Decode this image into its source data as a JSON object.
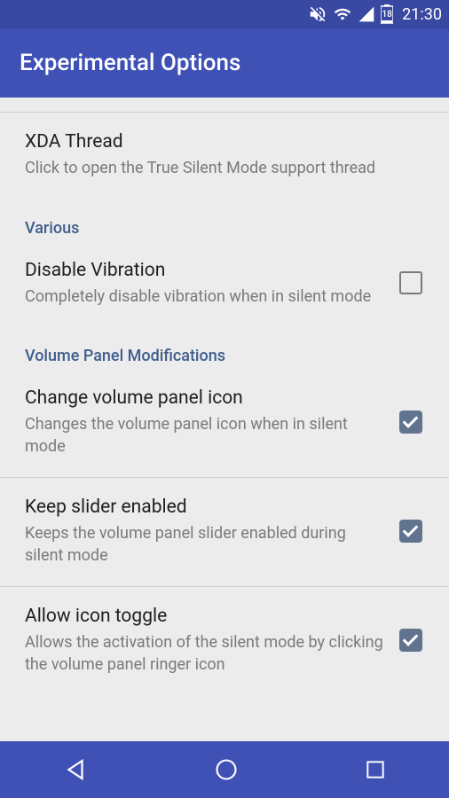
{
  "status": {
    "time": "21:30",
    "battery": "18"
  },
  "appbar": {
    "title": "Experimental Options"
  },
  "items": {
    "xda": {
      "title": "XDA Thread",
      "subtitle": "Click to open the True Silent Mode support thread"
    }
  },
  "sections": {
    "various": {
      "header": "Various",
      "disable_vibration": {
        "title": "Disable Vibration",
        "subtitle": "Completely disable vibration when in silent mode",
        "checked": false
      }
    },
    "volume_panel": {
      "header": "Volume Panel Modifications",
      "change_icon": {
        "title": "Change volume panel icon",
        "subtitle": "Changes the volume panel icon when in silent mode",
        "checked": true
      },
      "keep_slider": {
        "title": "Keep slider enabled",
        "subtitle": "Keeps the volume panel slider enabled during silent mode",
        "checked": true
      },
      "allow_toggle": {
        "title": "Allow icon toggle",
        "subtitle": "Allows the activation of the silent mode by clicking the volume panel ringer icon",
        "checked": true
      }
    }
  }
}
